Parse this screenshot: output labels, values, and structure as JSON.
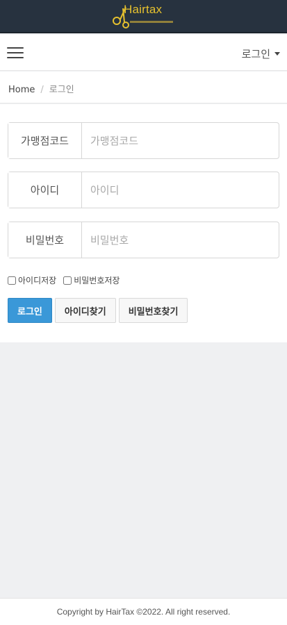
{
  "header": {
    "logo_text": "Hairtax"
  },
  "navbar": {
    "login_menu_label": "로그인"
  },
  "breadcrumb": {
    "home": "Home",
    "separator": "/",
    "current": "로그인"
  },
  "form": {
    "store_code": {
      "label": "가맹점코드",
      "placeholder": "가맹점코드",
      "value": ""
    },
    "user_id": {
      "label": "아이디",
      "placeholder": "아이디",
      "value": ""
    },
    "password": {
      "label": "비밀번호",
      "placeholder": "비밀번호",
      "value": ""
    },
    "save_id_label": "아이디저장",
    "save_password_label": "비밀번호저장"
  },
  "buttons": {
    "login": "로그인",
    "find_id": "아이디찾기",
    "find_password": "비밀번호찾기"
  },
  "footer": {
    "copyright": "Copyright by HairTax ©2022. All right reserved."
  },
  "colors": {
    "header_bg": "#27323f",
    "logo_gold": "#e6c12e",
    "primary": "#3a98d8",
    "page_bg": "#eff0f2"
  }
}
